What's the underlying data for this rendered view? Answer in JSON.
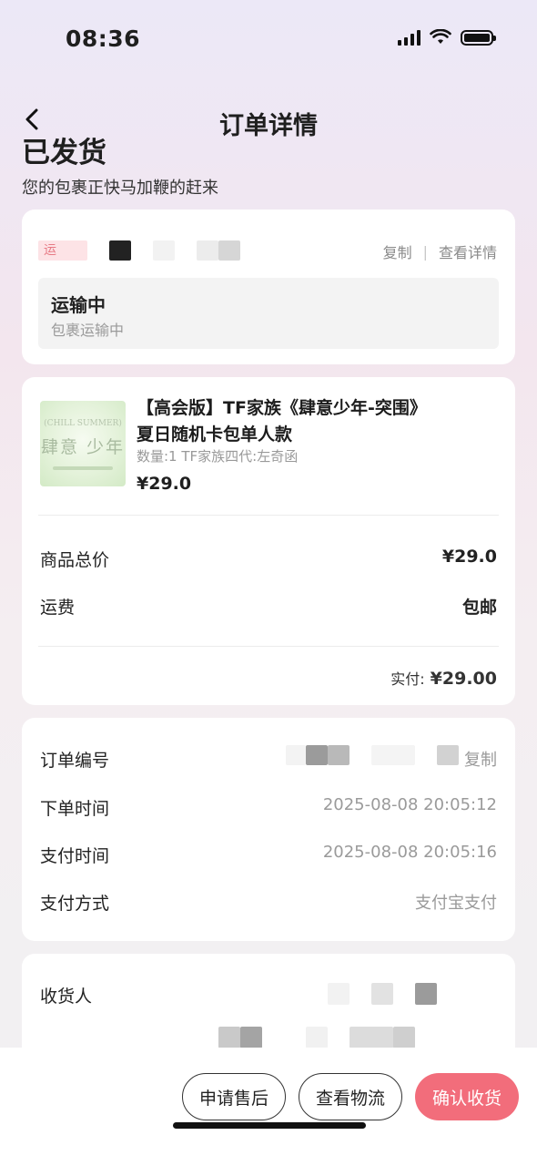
{
  "status_bar": {
    "time": "08:36"
  },
  "header": {
    "title": "订单详情",
    "back_icon": "chevron-left-icon"
  },
  "shipping": {
    "title": "已发货",
    "subtitle": "您的包裹正快马加鞭的赶来"
  },
  "logistics": {
    "carrier_label": "运",
    "copy_label": "复制",
    "separator": "|",
    "details_label": "查看详情",
    "status_title": "运输中",
    "status_sub": "包裹运输中"
  },
  "product": {
    "name_line1": "【高会版】TF家族《肆意少年-突围》",
    "name_line2": "夏日随机卡包单人款",
    "spec": "数量:1 TF家族四代:左奇函",
    "price": "¥29.0",
    "image_text_top": "(CHILL SUMMER)",
    "image_text_main": "肆意 少年"
  },
  "cost": {
    "total_label": "商品总价",
    "total_value": "¥29.0",
    "shipping_label": "运费",
    "shipping_value": "包邮",
    "paid_label": "实付:",
    "paid_value": "¥29.00"
  },
  "order_info": {
    "order_no_label": "订单编号",
    "copy_label": "复制",
    "order_time_label": "下单时间",
    "order_time": "2025-08-08 20:05:12",
    "pay_time_label": "支付时间",
    "pay_time": "2025-08-08 20:05:16",
    "pay_method_label": "支付方式",
    "pay_method": "支付宝支付"
  },
  "receiver": {
    "label": "收货人"
  },
  "actions": {
    "after_sale": "申请售后",
    "view_logistics": "查看物流",
    "confirm_receipt": "确认收货"
  },
  "colors": {
    "accent": "#f26d7b"
  }
}
